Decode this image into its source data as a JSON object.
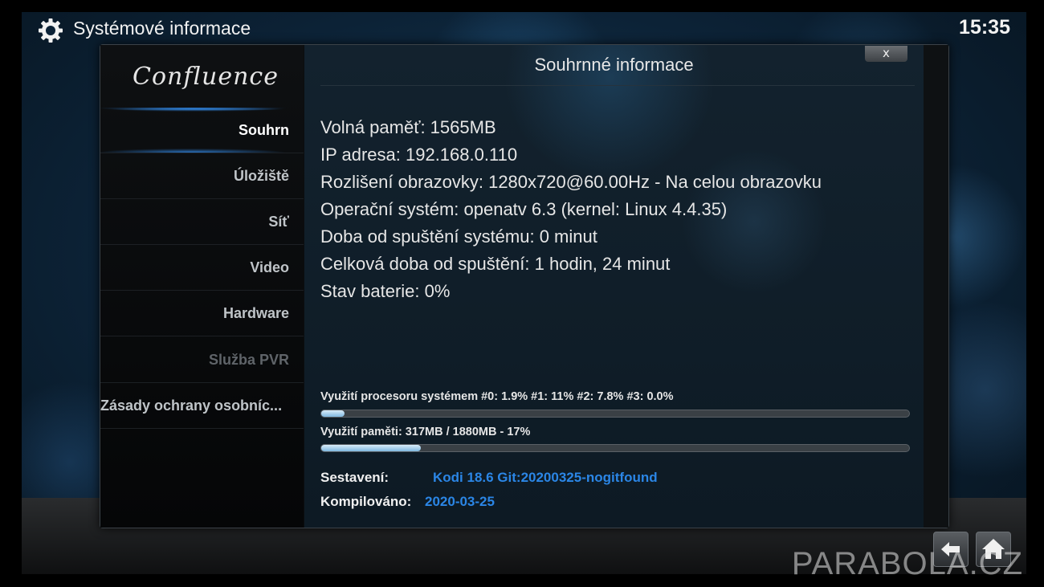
{
  "header": {
    "title": "Systémové informace",
    "clock": "15:35"
  },
  "sidebar": {
    "logo": "Confluence",
    "items": [
      {
        "label": "Souhrn",
        "state": "active"
      },
      {
        "label": "Úložiště",
        "state": "normal"
      },
      {
        "label": "Síť",
        "state": "normal"
      },
      {
        "label": "Video",
        "state": "normal"
      },
      {
        "label": "Hardware",
        "state": "normal"
      },
      {
        "label": "Služba PVR",
        "state": "disabled"
      },
      {
        "label": "Zásady ochrany osobníc...",
        "state": "normal"
      }
    ]
  },
  "dialog": {
    "title": "Souhrnné informace",
    "close_label": "x"
  },
  "info": {
    "lines": [
      "Volná paměť: 1565MB",
      "IP adresa: 192.168.0.110",
      "Rozlišení obrazovky: 1280x720@60.00Hz - Na celou obrazovku",
      "Operační systém: openatv 6.3 (kernel: Linux 4.4.35)",
      "Doba od spuštění systému: 0 minut",
      "Celková doba od spuštění: 1 hodin, 24 minut",
      "Stav baterie: 0%"
    ]
  },
  "usage": {
    "cpu": {
      "label": "Využití procesoru systémem #0: 1.9% #1:  11% #2: 7.8% #3: 0.0%",
      "fraction": 0.04
    },
    "memory": {
      "label": "Využití paměti: 317MB / 1880MB - 17%",
      "fraction": 0.17
    }
  },
  "build": {
    "build_label": "Sestavení:",
    "build_value": "Kodi 18.6 Git:20200325-nogitfound",
    "compiled_label": "Kompilováno:",
    "compiled_value": "2020-03-25"
  },
  "footer": {
    "back_icon": "back-arrow-icon",
    "home_icon": "home-icon",
    "watermark": "PARABOLA.CZ"
  },
  "colors": {
    "accent_blue": "#2b86e6",
    "active_glow": "#2e7fd6"
  }
}
